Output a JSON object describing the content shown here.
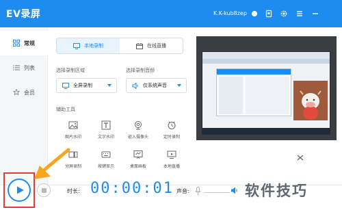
{
  "app": {
    "title": "EV录屏",
    "user_name": "K.K-kub8zep",
    "title_icons": [
      "record-dot-icon",
      "bookmark-icon",
      "settings-icon",
      "menu-icon",
      "minimize-icon"
    ]
  },
  "sidebar": {
    "items": [
      {
        "label": "常规",
        "icon": "grid-icon",
        "active": true
      },
      {
        "label": "列表",
        "icon": "list-icon",
        "active": false
      },
      {
        "label": "会员",
        "icon": "star-icon",
        "active": false
      }
    ]
  },
  "mode_tabs": [
    {
      "label": "本地录制",
      "icon": "monitor-icon",
      "active": true
    },
    {
      "label": "在线直播",
      "icon": "calendar-icon",
      "active": false
    }
  ],
  "capture_area": {
    "label": "选择录制区域",
    "value": "全屏录制",
    "icon": "monitor-icon"
  },
  "capture_audio": {
    "label": "选择录制音频",
    "value": "仅系统声音",
    "icon": "speaker-icon"
  },
  "tools": {
    "heading": "辅助工具",
    "items": [
      {
        "label": "图片水印",
        "icon": "image-icon"
      },
      {
        "label": "文字水印",
        "icon": "text-icon"
      },
      {
        "label": "嵌入摄像头",
        "icon": "camera-icon"
      },
      {
        "label": "定时录制",
        "icon": "clock-icon"
      },
      {
        "label": "分屏录制",
        "icon": "split-screen-icon"
      },
      {
        "label": "按键显示",
        "icon": "keyboard-icon"
      },
      {
        "label": "桌面画板",
        "icon": "whiteboard-icon"
      },
      {
        "label": "本地直播",
        "icon": "broadcast-icon"
      }
    ]
  },
  "bottom": {
    "duration_label": "时长:",
    "timer": "00:00:01",
    "volume_label": "声音:"
  },
  "watermark": "软件技巧",
  "colors": {
    "accent": "#1d8bef",
    "highlight": "#e53935",
    "arrow": "#f5a623"
  }
}
